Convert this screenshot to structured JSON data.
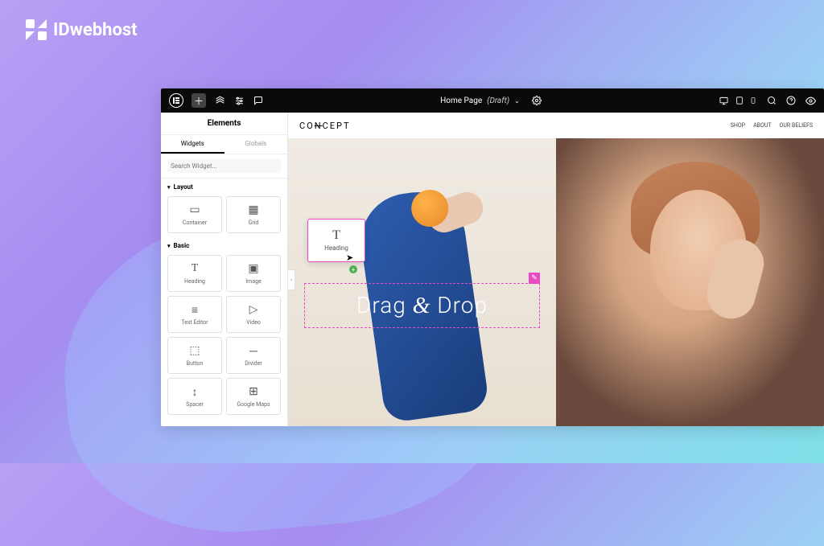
{
  "brand": {
    "name": "IDwebhost"
  },
  "titlebar": {
    "page_name": "Home Page",
    "page_status": "(Draft)"
  },
  "sidebar": {
    "title": "Elements",
    "tabs": {
      "widgets": "Widgets",
      "globals": "Globals"
    },
    "search_placeholder": "Search Widget...",
    "sections": {
      "layout": {
        "label": "Layout",
        "items": [
          {
            "label": "Container",
            "icon": "▭"
          },
          {
            "label": "Grid",
            "icon": "▦"
          }
        ]
      },
      "basic": {
        "label": "Basic",
        "items": [
          {
            "label": "Heading",
            "icon": "T"
          },
          {
            "label": "Image",
            "icon": "▣"
          },
          {
            "label": "Text Editor",
            "icon": "≡"
          },
          {
            "label": "Video",
            "icon": "▷"
          },
          {
            "label": "Button",
            "icon": "⬚"
          },
          {
            "label": "Divider",
            "icon": "─"
          },
          {
            "label": "Spacer",
            "icon": "↕"
          },
          {
            "label": "Google Maps",
            "icon": "⊞"
          }
        ]
      }
    }
  },
  "canvas": {
    "site_logo_parts": {
      "a": "CO",
      "b": "N",
      "c": "CEPT"
    },
    "nav": [
      "SHOP",
      "ABOUT",
      "OUR BELIEFS"
    ],
    "drag_widget_label": "Heading",
    "drop_text_parts": {
      "a": "Drag ",
      "amp": "&",
      "c": " Drop"
    },
    "selection_actions": {
      "plus": "+",
      "grid": "⋮⋮",
      "close": "✕"
    }
  },
  "colors": {
    "accent_pink": "#e949c5",
    "titlebar_bg": "#0a0a0a"
  }
}
